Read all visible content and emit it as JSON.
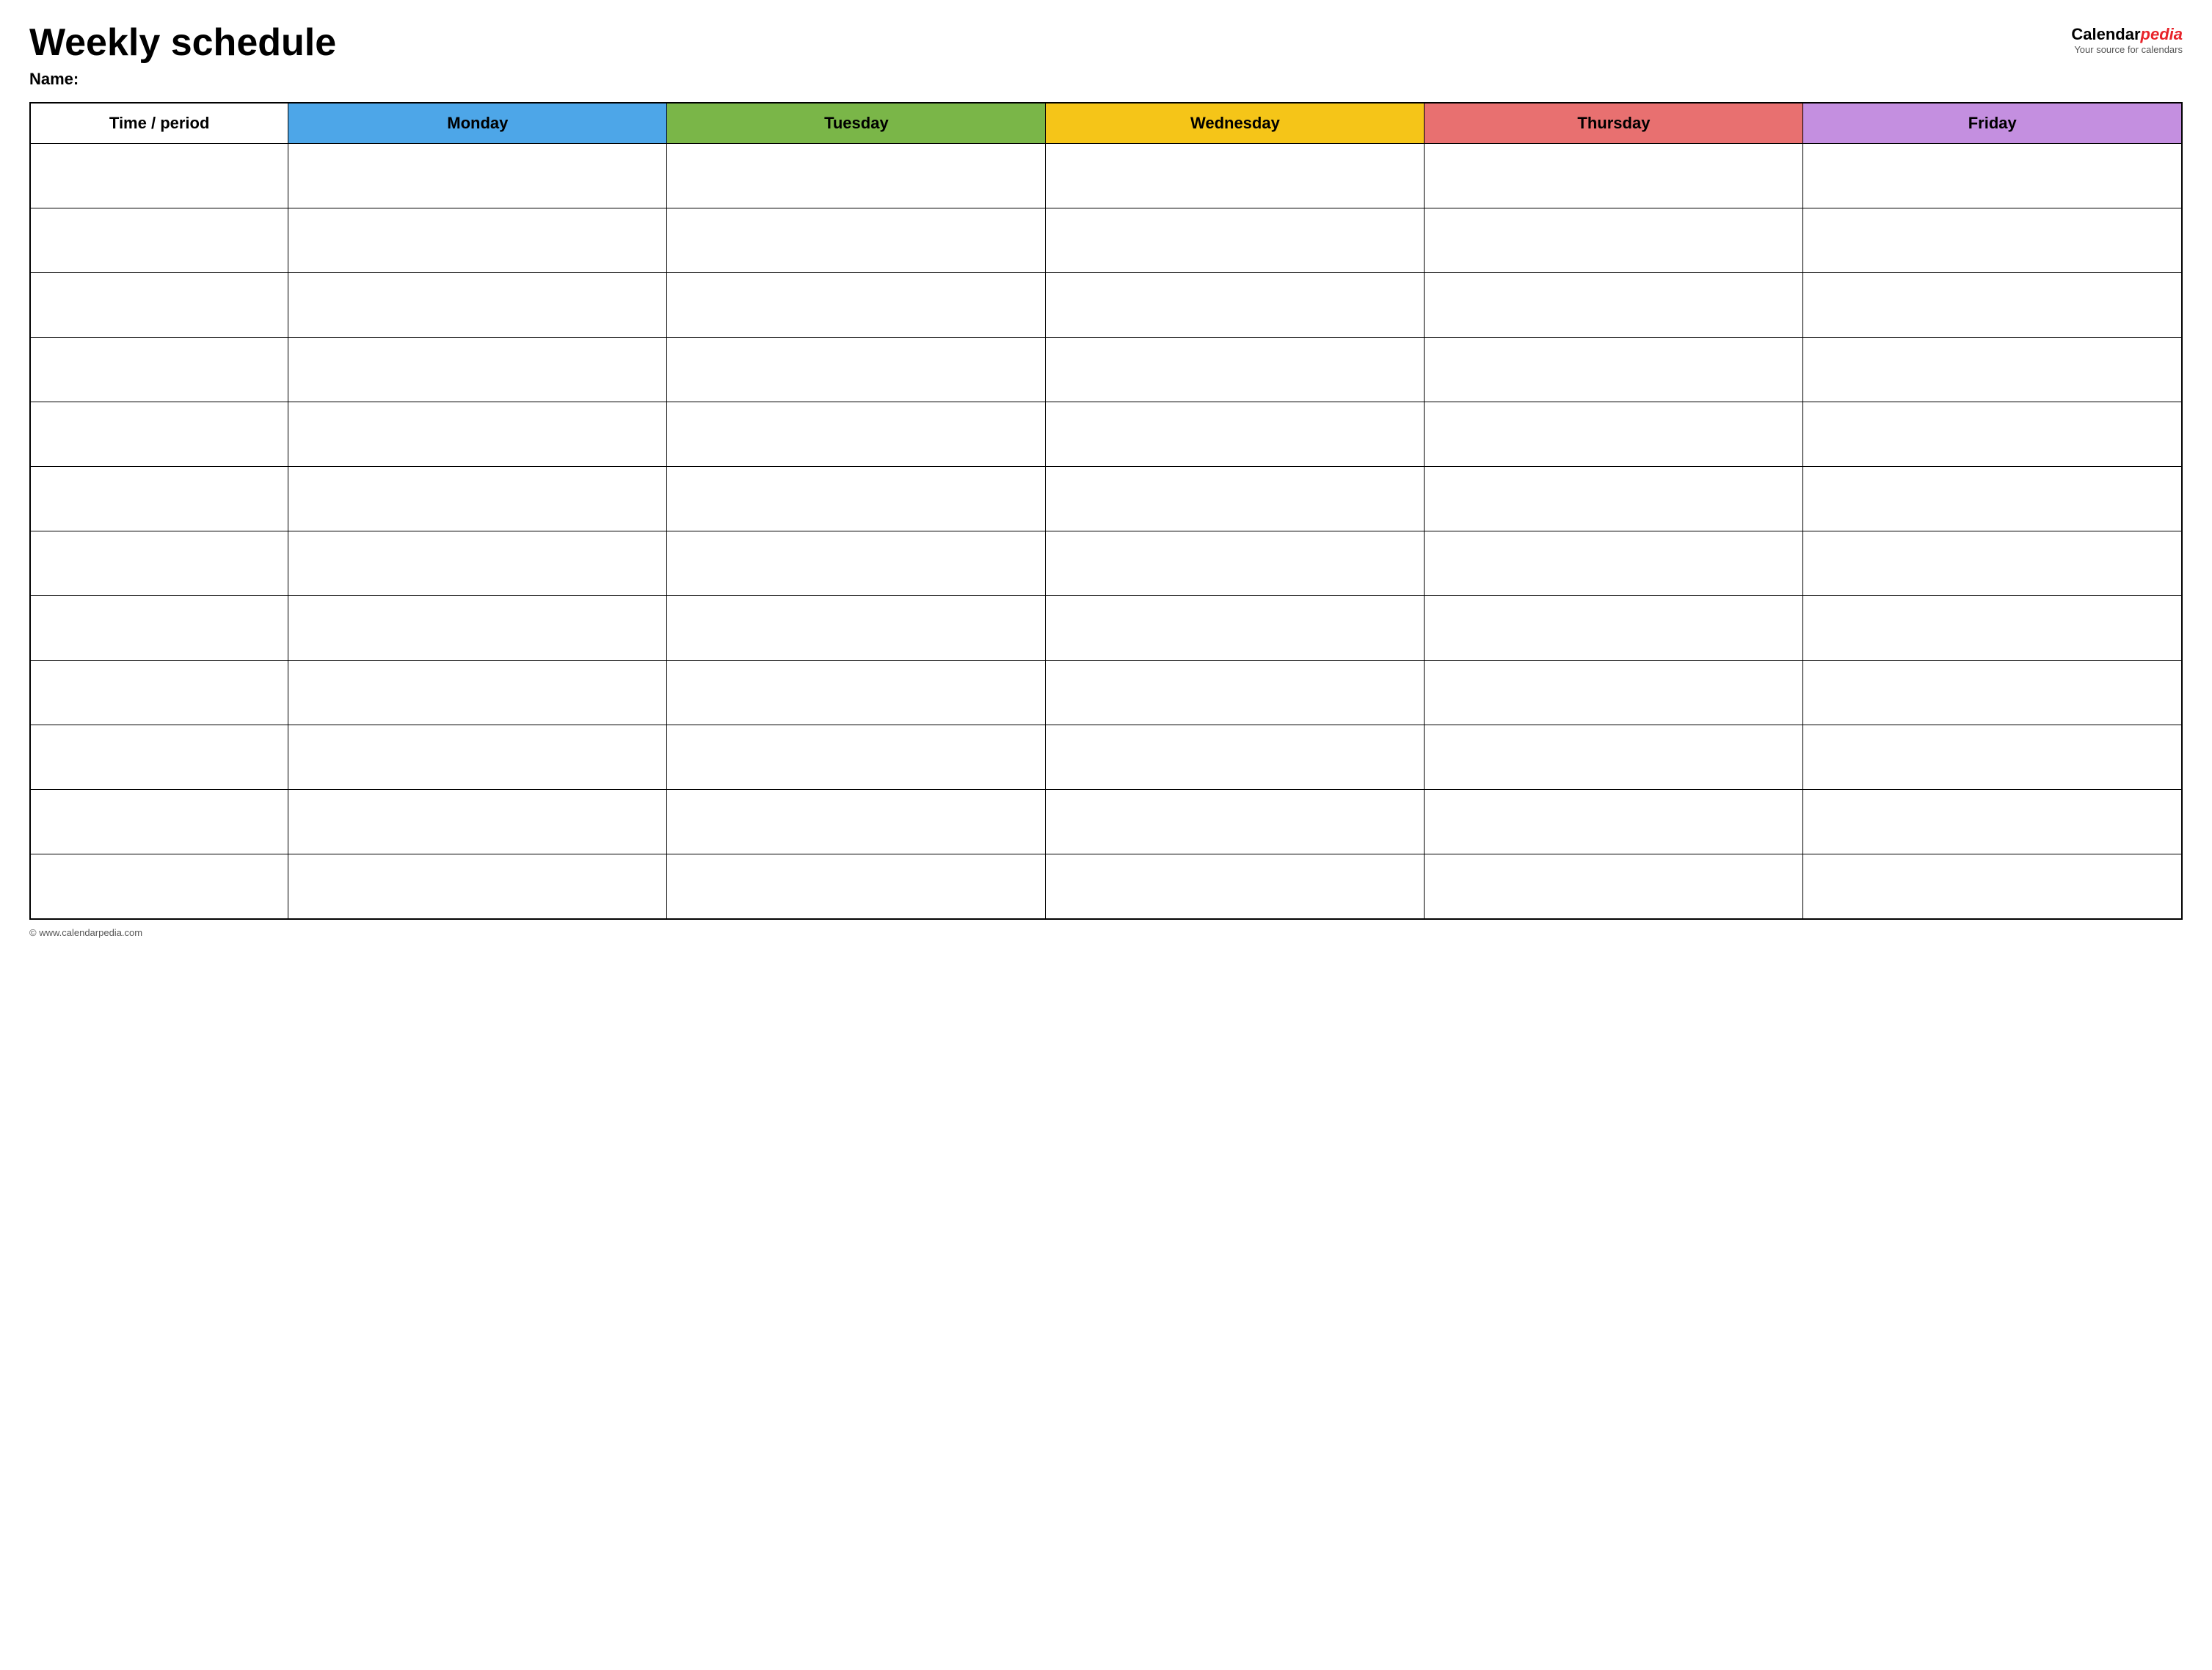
{
  "header": {
    "title": "Weekly schedule",
    "name_label": "Name:",
    "logo_part1": "Calendar",
    "logo_part2": "pedia",
    "logo_subtitle": "Your source for calendars"
  },
  "table": {
    "columns": [
      {
        "key": "time",
        "label": "Time / period",
        "color": "#ffffff",
        "class": "th-time"
      },
      {
        "key": "monday",
        "label": "Monday",
        "color": "#4da6e8",
        "class": "th-monday"
      },
      {
        "key": "tuesday",
        "label": "Tuesday",
        "color": "#7ab648",
        "class": "th-tuesday"
      },
      {
        "key": "wednesday",
        "label": "Wednesday",
        "color": "#f5c518",
        "class": "th-wednesday"
      },
      {
        "key": "thursday",
        "label": "Thursday",
        "color": "#e87070",
        "class": "th-thursday"
      },
      {
        "key": "friday",
        "label": "Friday",
        "color": "#c48fe0",
        "class": "th-friday"
      }
    ],
    "row_count": 12
  },
  "footer": {
    "url": "© www.calendarpedia.com"
  }
}
